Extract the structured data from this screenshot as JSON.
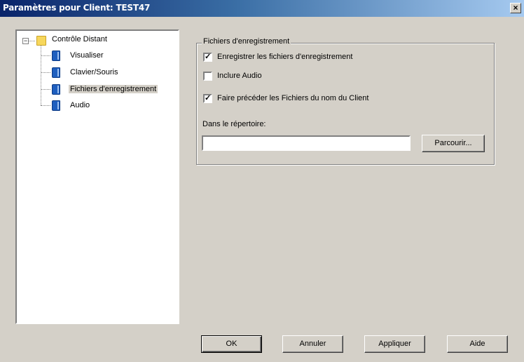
{
  "window": {
    "title": "Paramètres pour Client: TEST47",
    "close_glyph": "×"
  },
  "tree": {
    "expander_glyph": "−",
    "root": {
      "label": "Contrôle Distant",
      "icon": "folder-icon"
    },
    "children": [
      {
        "label": "Visualiser",
        "icon": "book-icon",
        "selected": false
      },
      {
        "label": "Clavier/Souris",
        "icon": "book-icon",
        "selected": false
      },
      {
        "label": "Fichiers d'enregistrement",
        "icon": "book-icon",
        "selected": true
      },
      {
        "label": "Audio",
        "icon": "book-icon",
        "selected": false
      }
    ]
  },
  "recording_group": {
    "legend": "Fichiers d'enregistrement",
    "check_glyph": "✓",
    "options": [
      {
        "label": "Enregistrer les fichiers d'enregistrement",
        "checked": true
      },
      {
        "label": "Inclure Audio",
        "checked": false
      },
      {
        "label": "Faire précéder les Fichiers du nom du Client",
        "checked": true
      }
    ],
    "directory_label": "Dans le répertoire:",
    "directory_value": "",
    "browse_button": "Parcourir..."
  },
  "buttons": {
    "ok": "OK",
    "cancel": "Annuler",
    "apply": "Appliquer",
    "help": "Aide"
  }
}
